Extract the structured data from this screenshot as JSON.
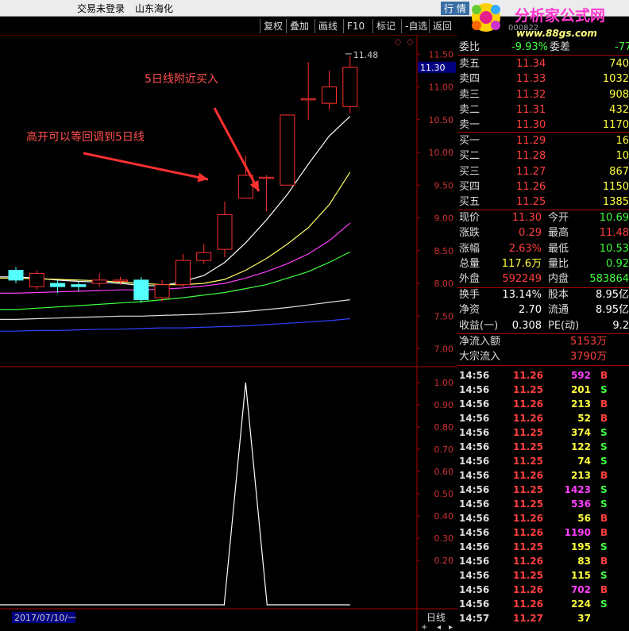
{
  "title": {
    "login": "交易未登录",
    "stock_name": "山东海化",
    "menu": "行 情"
  },
  "logo": {
    "name": "分析家公式网",
    "url": "www.88gs.com",
    "code": "000822"
  },
  "toolbar": {
    "buttons": [
      "复权",
      "叠加",
      "画线",
      "F10",
      "标记",
      "-自选",
      "返回"
    ]
  },
  "chart_data": {
    "type": "candlestick",
    "upper_yticks": [
      "11.50",
      "11.00",
      "10.50",
      "10.00",
      "9.50",
      "9.00",
      "8.50",
      "8.00",
      "7.50",
      "7.00"
    ],
    "upper_ylim": [
      6.8,
      11.6
    ],
    "lower_yticks": [
      "1.00",
      "0.90",
      "0.80",
      "0.70",
      "0.60",
      "0.50",
      "0.40",
      "0.30",
      "0.20"
    ],
    "lower_ylim": [
      0,
      1.0
    ],
    "current_price_label": "11.30",
    "high_annotation": "11.48",
    "date_label": "2017/07/10/一",
    "period_label": "日线",
    "candles": [
      {
        "o": 8.2,
        "c": 8.05,
        "h": 8.25,
        "l": 8.0
      },
      {
        "o": 7.95,
        "c": 8.15,
        "h": 8.2,
        "l": 7.9
      },
      {
        "o": 8.0,
        "c": 7.95,
        "h": 8.05,
        "l": 7.85
      },
      {
        "o": 7.98,
        "c": 7.95,
        "h": 8.02,
        "l": 7.88
      },
      {
        "o": 8.0,
        "c": 8.05,
        "h": 8.15,
        "l": 7.95
      },
      {
        "o": 8.05,
        "c": 8.05,
        "h": 8.1,
        "l": 7.98
      },
      {
        "o": 8.05,
        "c": 7.75,
        "h": 8.1,
        "l": 7.7
      },
      {
        "o": 7.78,
        "c": 7.98,
        "h": 8.05,
        "l": 7.72
      },
      {
        "o": 7.98,
        "c": 8.35,
        "h": 8.45,
        "l": 7.95
      },
      {
        "o": 8.35,
        "c": 8.47,
        "h": 8.6,
        "l": 8.3
      },
      {
        "o": 8.52,
        "c": 9.05,
        "h": 9.25,
        "l": 8.4
      },
      {
        "o": 9.3,
        "c": 9.65,
        "h": 9.95,
        "l": 9.3
      },
      {
        "o": 9.62,
        "c": 9.62,
        "h": 9.65,
        "l": 9.1
      },
      {
        "o": 9.5,
        "c": 10.57,
        "h": 10.57,
        "l": 9.5
      },
      {
        "o": 10.82,
        "c": 10.82,
        "h": 11.38,
        "l": 10.5
      },
      {
        "o": 10.75,
        "c": 11.0,
        "h": 11.25,
        "l": 10.65
      },
      {
        "o": 10.7,
        "c": 11.3,
        "h": 11.48,
        "l": 10.6
      }
    ],
    "ma5": [
      8.1,
      8.08,
      8.05,
      8.03,
      8.02,
      8.0,
      7.97,
      7.96,
      8.03,
      8.12,
      8.32,
      8.62,
      8.97,
      9.36,
      9.82,
      10.25,
      10.55
    ],
    "ma10": [
      8.08,
      8.07,
      8.06,
      8.05,
      8.04,
      8.02,
      8.0,
      7.98,
      7.98,
      8.0,
      8.06,
      8.2,
      8.38,
      8.6,
      8.85,
      9.2,
      9.7
    ],
    "ma20": [
      7.85,
      7.86,
      7.87,
      7.88,
      7.89,
      7.9,
      7.9,
      7.91,
      7.93,
      7.96,
      8.0,
      8.08,
      8.18,
      8.3,
      8.45,
      8.65,
      8.92
    ],
    "ma30": [
      7.6,
      7.62,
      7.64,
      7.66,
      7.68,
      7.7,
      7.72,
      7.75,
      7.78,
      7.82,
      7.86,
      7.92,
      7.98,
      8.08,
      8.18,
      8.32,
      8.48
    ],
    "ma60": [
      7.45,
      7.46,
      7.47,
      7.48,
      7.49,
      7.5,
      7.5,
      7.51,
      7.52,
      7.53,
      7.55,
      7.57,
      7.6,
      7.63,
      7.67,
      7.71,
      7.75
    ],
    "ma120": [
      7.27,
      7.28,
      7.28,
      7.29,
      7.3,
      7.3,
      7.31,
      7.32,
      7.32,
      7.33,
      7.34,
      7.35,
      7.37,
      7.39,
      7.41,
      7.43,
      7.46
    ],
    "signal": [
      0,
      0,
      0,
      0,
      0,
      0,
      0,
      0,
      0,
      0,
      0,
      1,
      0,
      0,
      0,
      0,
      0
    ],
    "annotations": [
      {
        "text": "5日线附近买入"
      },
      {
        "text": "高开可以等回调到5日线"
      }
    ]
  },
  "quote": {
    "header": {
      "label1": "委比",
      "val1": "-9.93%",
      "label2": "委差",
      "val2": "-77"
    },
    "asks": [
      {
        "label": "卖五",
        "price": "11.34",
        "vol": "740"
      },
      {
        "label": "卖四",
        "price": "11.33",
        "vol": "1032"
      },
      {
        "label": "卖三",
        "price": "11.32",
        "vol": "908"
      },
      {
        "label": "卖二",
        "price": "11.31",
        "vol": "432"
      },
      {
        "label": "卖一",
        "price": "11.30",
        "vol": "1170"
      }
    ],
    "bids": [
      {
        "label": "买一",
        "price": "11.29",
        "vol": "16"
      },
      {
        "label": "买二",
        "price": "11.28",
        "vol": "10"
      },
      {
        "label": "买三",
        "price": "11.27",
        "vol": "867"
      },
      {
        "label": "买四",
        "price": "11.26",
        "vol": "1150"
      },
      {
        "label": "买五",
        "price": "11.25",
        "vol": "1385"
      }
    ],
    "stats": [
      {
        "l1": "现价",
        "v1": "11.30",
        "c1": "red",
        "l2": "今开",
        "v2": "10.69",
        "c2": "green"
      },
      {
        "l1": "涨跌",
        "v1": "0.29",
        "c1": "red",
        "l2": "最高",
        "v2": "11.48",
        "c2": "red"
      },
      {
        "l1": "涨幅",
        "v1": "2.63%",
        "c1": "red",
        "l2": "最低",
        "v2": "10.53",
        "c2": "green"
      },
      {
        "l1": "总量",
        "v1": "117.6万",
        "c1": "yellow",
        "l2": "量比",
        "v2": "0.92",
        "c2": "green"
      },
      {
        "l1": "外盘",
        "v1": "592249",
        "c1": "red",
        "l2": "内盘",
        "v2": "583864",
        "c2": "green"
      }
    ],
    "stats2": [
      {
        "l1": "换手",
        "v1": "13.14%",
        "l2": "股本",
        "v2": "8.95亿"
      },
      {
        "l1": "净资",
        "v1": "2.70",
        "l2": "流通",
        "v2": "8.95亿"
      },
      {
        "l1": "收益(一)",
        "v1": "0.308",
        "l2": "PE(动)",
        "v2": "9.2"
      }
    ],
    "flow": [
      {
        "label": "净流入额",
        "val": "5153万"
      },
      {
        "label": "大宗流入",
        "val": "3790万"
      }
    ],
    "ticks": [
      {
        "t": "14:56",
        "p": "11.26",
        "v": "592",
        "vc": "magenta",
        "bs": "B"
      },
      {
        "t": "14:56",
        "p": "11.25",
        "v": "201",
        "vc": "yellow",
        "bs": "S"
      },
      {
        "t": "14:56",
        "p": "11.26",
        "v": "213",
        "vc": "yellow",
        "bs": "B"
      },
      {
        "t": "14:56",
        "p": "11.26",
        "v": "52",
        "vc": "yellow",
        "bs": "B"
      },
      {
        "t": "14:56",
        "p": "11.25",
        "v": "374",
        "vc": "yellow",
        "bs": "S"
      },
      {
        "t": "14:56",
        "p": "11.25",
        "v": "122",
        "vc": "yellow",
        "bs": "S"
      },
      {
        "t": "14:56",
        "p": "11.25",
        "v": "74",
        "vc": "yellow",
        "bs": "S"
      },
      {
        "t": "14:56",
        "p": "11.26",
        "v": "213",
        "vc": "yellow",
        "bs": "B"
      },
      {
        "t": "14:56",
        "p": "11.25",
        "v": "1423",
        "vc": "magenta",
        "bs": "S"
      },
      {
        "t": "14:56",
        "p": "11.25",
        "v": "536",
        "vc": "magenta",
        "bs": "S"
      },
      {
        "t": "14:56",
        "p": "11.26",
        "v": "56",
        "vc": "yellow",
        "bs": "B"
      },
      {
        "t": "14:56",
        "p": "11.26",
        "v": "1190",
        "vc": "magenta",
        "bs": "B"
      },
      {
        "t": "14:56",
        "p": "11.25",
        "v": "195",
        "vc": "yellow",
        "bs": "S"
      },
      {
        "t": "14:56",
        "p": "11.26",
        "v": "83",
        "vc": "yellow",
        "bs": "B"
      },
      {
        "t": "14:56",
        "p": "11.25",
        "v": "115",
        "vc": "yellow",
        "bs": "S"
      },
      {
        "t": "14:56",
        "p": "11.26",
        "v": "702",
        "vc": "magenta",
        "bs": "B"
      },
      {
        "t": "14:56",
        "p": "11.26",
        "v": "224",
        "vc": "yellow",
        "bs": "S"
      },
      {
        "t": "14:57",
        "p": "11.27",
        "v": "37",
        "vc": "yellow",
        "bs": ""
      }
    ]
  }
}
